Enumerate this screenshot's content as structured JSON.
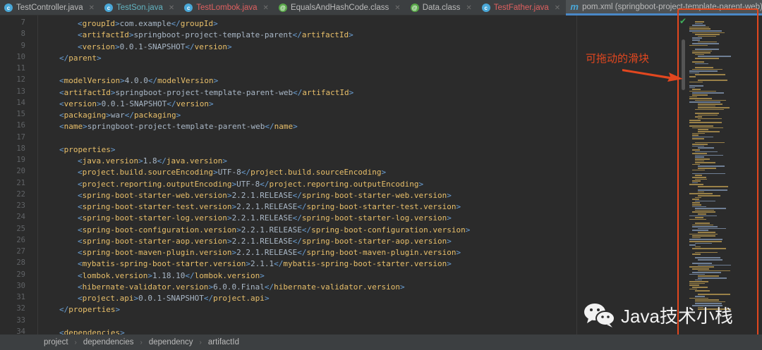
{
  "tabs": [
    {
      "label": "TestController.java",
      "icon": "class-icon",
      "color": "#4aa8d8",
      "state": "normal"
    },
    {
      "label": "TestSon.java",
      "icon": "class-icon",
      "color": "#4aa8d8",
      "state": "modified"
    },
    {
      "label": "TestLombok.java",
      "icon": "class-icon",
      "color": "#4aa8d8",
      "state": "error"
    },
    {
      "label": "EqualsAndHashCode.class",
      "icon": "annotation-icon",
      "color": "#5aa84a",
      "state": "normal"
    },
    {
      "label": "Data.class",
      "icon": "annotation-icon",
      "color": "#5aa84a",
      "state": "normal"
    },
    {
      "label": "TestFather.java",
      "icon": "abstract-class-icon",
      "color": "#4aa8d8",
      "state": "error"
    },
    {
      "label": "pom.xml (springboot-project-template-parent-web)",
      "icon": "maven-icon",
      "color": "#4aa8d8",
      "state": "active"
    }
  ],
  "code": [
    {
      "num": "7",
      "indent": 2,
      "tag": "groupId",
      "value": "com.example"
    },
    {
      "num": "8",
      "indent": 2,
      "tag": "artifactId",
      "value": "springboot-project-template-parent"
    },
    {
      "num": "9",
      "indent": 2,
      "tag": "version",
      "value": "0.0.1-SNAPSHOT"
    },
    {
      "num": "10",
      "indent": 1,
      "close": "parent"
    },
    {
      "num": "11",
      "indent": 0
    },
    {
      "num": "12",
      "indent": 1,
      "tag": "modelVersion",
      "value": "4.0.0"
    },
    {
      "num": "13",
      "indent": 1,
      "tag": "artifactId",
      "value": "springboot-project-template-parent-web"
    },
    {
      "num": "14",
      "indent": 1,
      "tag": "version",
      "value": "0.0.1-SNAPSHOT"
    },
    {
      "num": "15",
      "indent": 1,
      "tag": "packaging",
      "value": "war"
    },
    {
      "num": "16",
      "indent": 1,
      "tag": "name",
      "value": "springboot-project-template-parent-web"
    },
    {
      "num": "17",
      "indent": 0
    },
    {
      "num": "18",
      "indent": 1,
      "open": "properties"
    },
    {
      "num": "19",
      "indent": 2,
      "tag": "java.version",
      "value": "1.8"
    },
    {
      "num": "20",
      "indent": 2,
      "tag": "project.build.sourceEncoding",
      "value": "UTF-8"
    },
    {
      "num": "21",
      "indent": 2,
      "tag": "project.reporting.outputEncoding",
      "value": "UTF-8"
    },
    {
      "num": "22",
      "indent": 2,
      "tag": "spring-boot-starter-web.version",
      "value": "2.2.1.RELEASE"
    },
    {
      "num": "23",
      "indent": 2,
      "tag": "spring-boot-starter-test.version",
      "value": "2.2.1.RELEASE"
    },
    {
      "num": "24",
      "indent": 2,
      "tag": "spring-boot-starter-log.version",
      "value": "2.2.1.RELEASE"
    },
    {
      "num": "25",
      "indent": 2,
      "tag": "spring-boot-configuration.version",
      "value": "2.2.1.RELEASE"
    },
    {
      "num": "26",
      "indent": 2,
      "tag": "spring-boot-starter-aop.version",
      "value": "2.2.1.RELEASE"
    },
    {
      "num": "27",
      "indent": 2,
      "tag": "spring-boot-maven-plugin.version",
      "value": "2.2.1.RELEASE"
    },
    {
      "num": "28",
      "indent": 2,
      "tag": "mybatis-spring-boot-starter.version",
      "value": "2.1.1"
    },
    {
      "num": "29",
      "indent": 2,
      "tag": "lombok.version",
      "value": "1.18.10"
    },
    {
      "num": "30",
      "indent": 2,
      "tag": "hibernate-validator.version",
      "value": "6.0.0.Final"
    },
    {
      "num": "31",
      "indent": 2,
      "tag": "project.api",
      "value": "0.0.1-SNAPSHOT"
    },
    {
      "num": "32",
      "indent": 1,
      "close": "properties"
    },
    {
      "num": "33",
      "indent": 0
    },
    {
      "num": "34",
      "indent": 1,
      "open": "dependencies"
    }
  ],
  "annotation": {
    "text": "可拖动的滑块",
    "color": "#e2471f"
  },
  "breadcrumb": [
    "project",
    "dependencies",
    "dependency",
    "artifactId"
  ],
  "watermark": {
    "text": "Java技术小栈",
    "icon": "wechat-icon"
  },
  "colors": {
    "background": "#2b2b2b",
    "tag": "#e8bf6a",
    "bracket": "#6a9fd4",
    "text": "#a9b7c6",
    "highlight_box": "#e2471f"
  }
}
